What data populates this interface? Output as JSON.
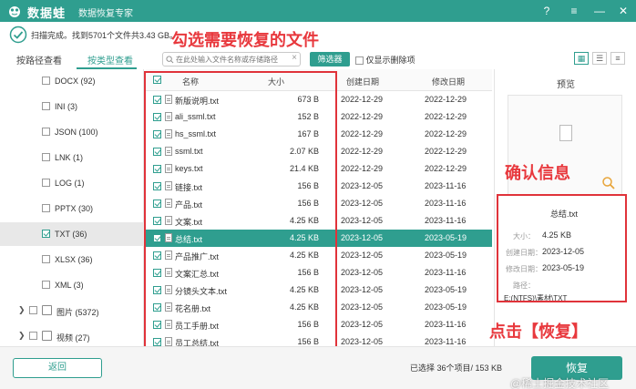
{
  "app": {
    "name": "数据蛙",
    "subtitle": "数据恢复专家",
    "brand_color": "#2f9e8f",
    "window_buttons": [
      "?",
      "≡",
      "—",
      "✕"
    ]
  },
  "status": {
    "text": "扫描完成。找到5701个文件共3.43 GB。"
  },
  "annotations": {
    "select_files": "勾选需要恢复的文件",
    "confirm_info": "确认信息",
    "click_recover": "点击【恢复】",
    "highlight_color": "#e0333a"
  },
  "tabs": [
    {
      "label": "按路径查看",
      "active": false
    },
    {
      "label": "按类型查看",
      "active": true
    }
  ],
  "toolbar": {
    "search_placeholder": "在此处输入文件名称或存储路径",
    "filter_label": "筛选器",
    "only_deleted_label": "仅显示删除项",
    "view_modes": [
      "grid-view-icon",
      "list-view-icon",
      "detail-view-icon"
    ]
  },
  "sidebar": {
    "items": [
      {
        "label": "DOCX (92)",
        "checked": false
      },
      {
        "label": "INI (3)",
        "checked": false
      },
      {
        "label": "JSON (100)",
        "checked": false
      },
      {
        "label": "LNK (1)",
        "checked": false
      },
      {
        "label": "LOG (1)",
        "checked": false
      },
      {
        "label": "PPTX (30)",
        "checked": false
      },
      {
        "label": "TXT (36)",
        "checked": true,
        "selected": true
      },
      {
        "label": "XLSX (36)",
        "checked": false
      },
      {
        "label": "XML (3)",
        "checked": false
      }
    ],
    "groups": [
      {
        "label": "图片 (5372)"
      },
      {
        "label": "视频 (27)"
      }
    ]
  },
  "table": {
    "columns": {
      "name": "名称",
      "size": "大小",
      "created": "创建日期",
      "modified": "修改日期"
    },
    "rows": [
      {
        "name": "新版说明.txt",
        "size": "673  B",
        "created": "2022-12-29",
        "modified": "2022-12-29"
      },
      {
        "name": "ali_ssml.txt",
        "size": "152  B",
        "created": "2022-12-29",
        "modified": "2022-12-29"
      },
      {
        "name": "hs_ssml.txt",
        "size": "167  B",
        "created": "2022-12-29",
        "modified": "2022-12-29"
      },
      {
        "name": "ssml.txt",
        "size": "2.07 KB",
        "created": "2022-12-29",
        "modified": "2022-12-29"
      },
      {
        "name": "keys.txt",
        "size": "21.4 KB",
        "created": "2022-12-29",
        "modified": "2022-12-29"
      },
      {
        "name": "链接.txt",
        "size": "156  B",
        "created": "2023-12-05",
        "modified": "2023-11-16"
      },
      {
        "name": "产品.txt",
        "size": "156  B",
        "created": "2023-12-05",
        "modified": "2023-11-16"
      },
      {
        "name": "文案.txt",
        "size": "4.25 KB",
        "created": "2023-12-05",
        "modified": "2023-11-16"
      },
      {
        "name": "总结.txt",
        "size": "4.25 KB",
        "created": "2023-12-05",
        "modified": "2023-05-19",
        "highlight": true
      },
      {
        "name": "产品推广.txt",
        "size": "4.25 KB",
        "created": "2023-12-05",
        "modified": "2023-05-19"
      },
      {
        "name": "文案汇总.txt",
        "size": "156  B",
        "created": "2023-12-05",
        "modified": "2023-11-16"
      },
      {
        "name": "分镜头文本.txt",
        "size": "4.25 KB",
        "created": "2023-12-05",
        "modified": "2023-05-19"
      },
      {
        "name": "花名册.txt",
        "size": "4.25 KB",
        "created": "2023-12-05",
        "modified": "2023-05-19"
      },
      {
        "name": "员工手册.txt",
        "size": "156  B",
        "created": "2023-12-05",
        "modified": "2023-11-16"
      },
      {
        "name": "员工总结.txt",
        "size": "156  B",
        "created": "2023-12-05",
        "modified": "2023-11-16"
      }
    ]
  },
  "preview": {
    "title": "预览",
    "file_name": "总结.txt",
    "fields": [
      {
        "key": "大小：",
        "value": "4.25 KB"
      },
      {
        "key": "创建日期：",
        "value": "2023-12-05"
      },
      {
        "key": "修改日期：",
        "value": "2023-05-19"
      },
      {
        "key": "路径：",
        "value": ""
      }
    ],
    "path": "E:(NTFS)\\素材\\TXT"
  },
  "bottom": {
    "back_label": "返回",
    "selection_text": "已选择 36个项目/ 153 KB",
    "recover_label": "恢复",
    "watermark": "@稀土掘金技术社区"
  }
}
